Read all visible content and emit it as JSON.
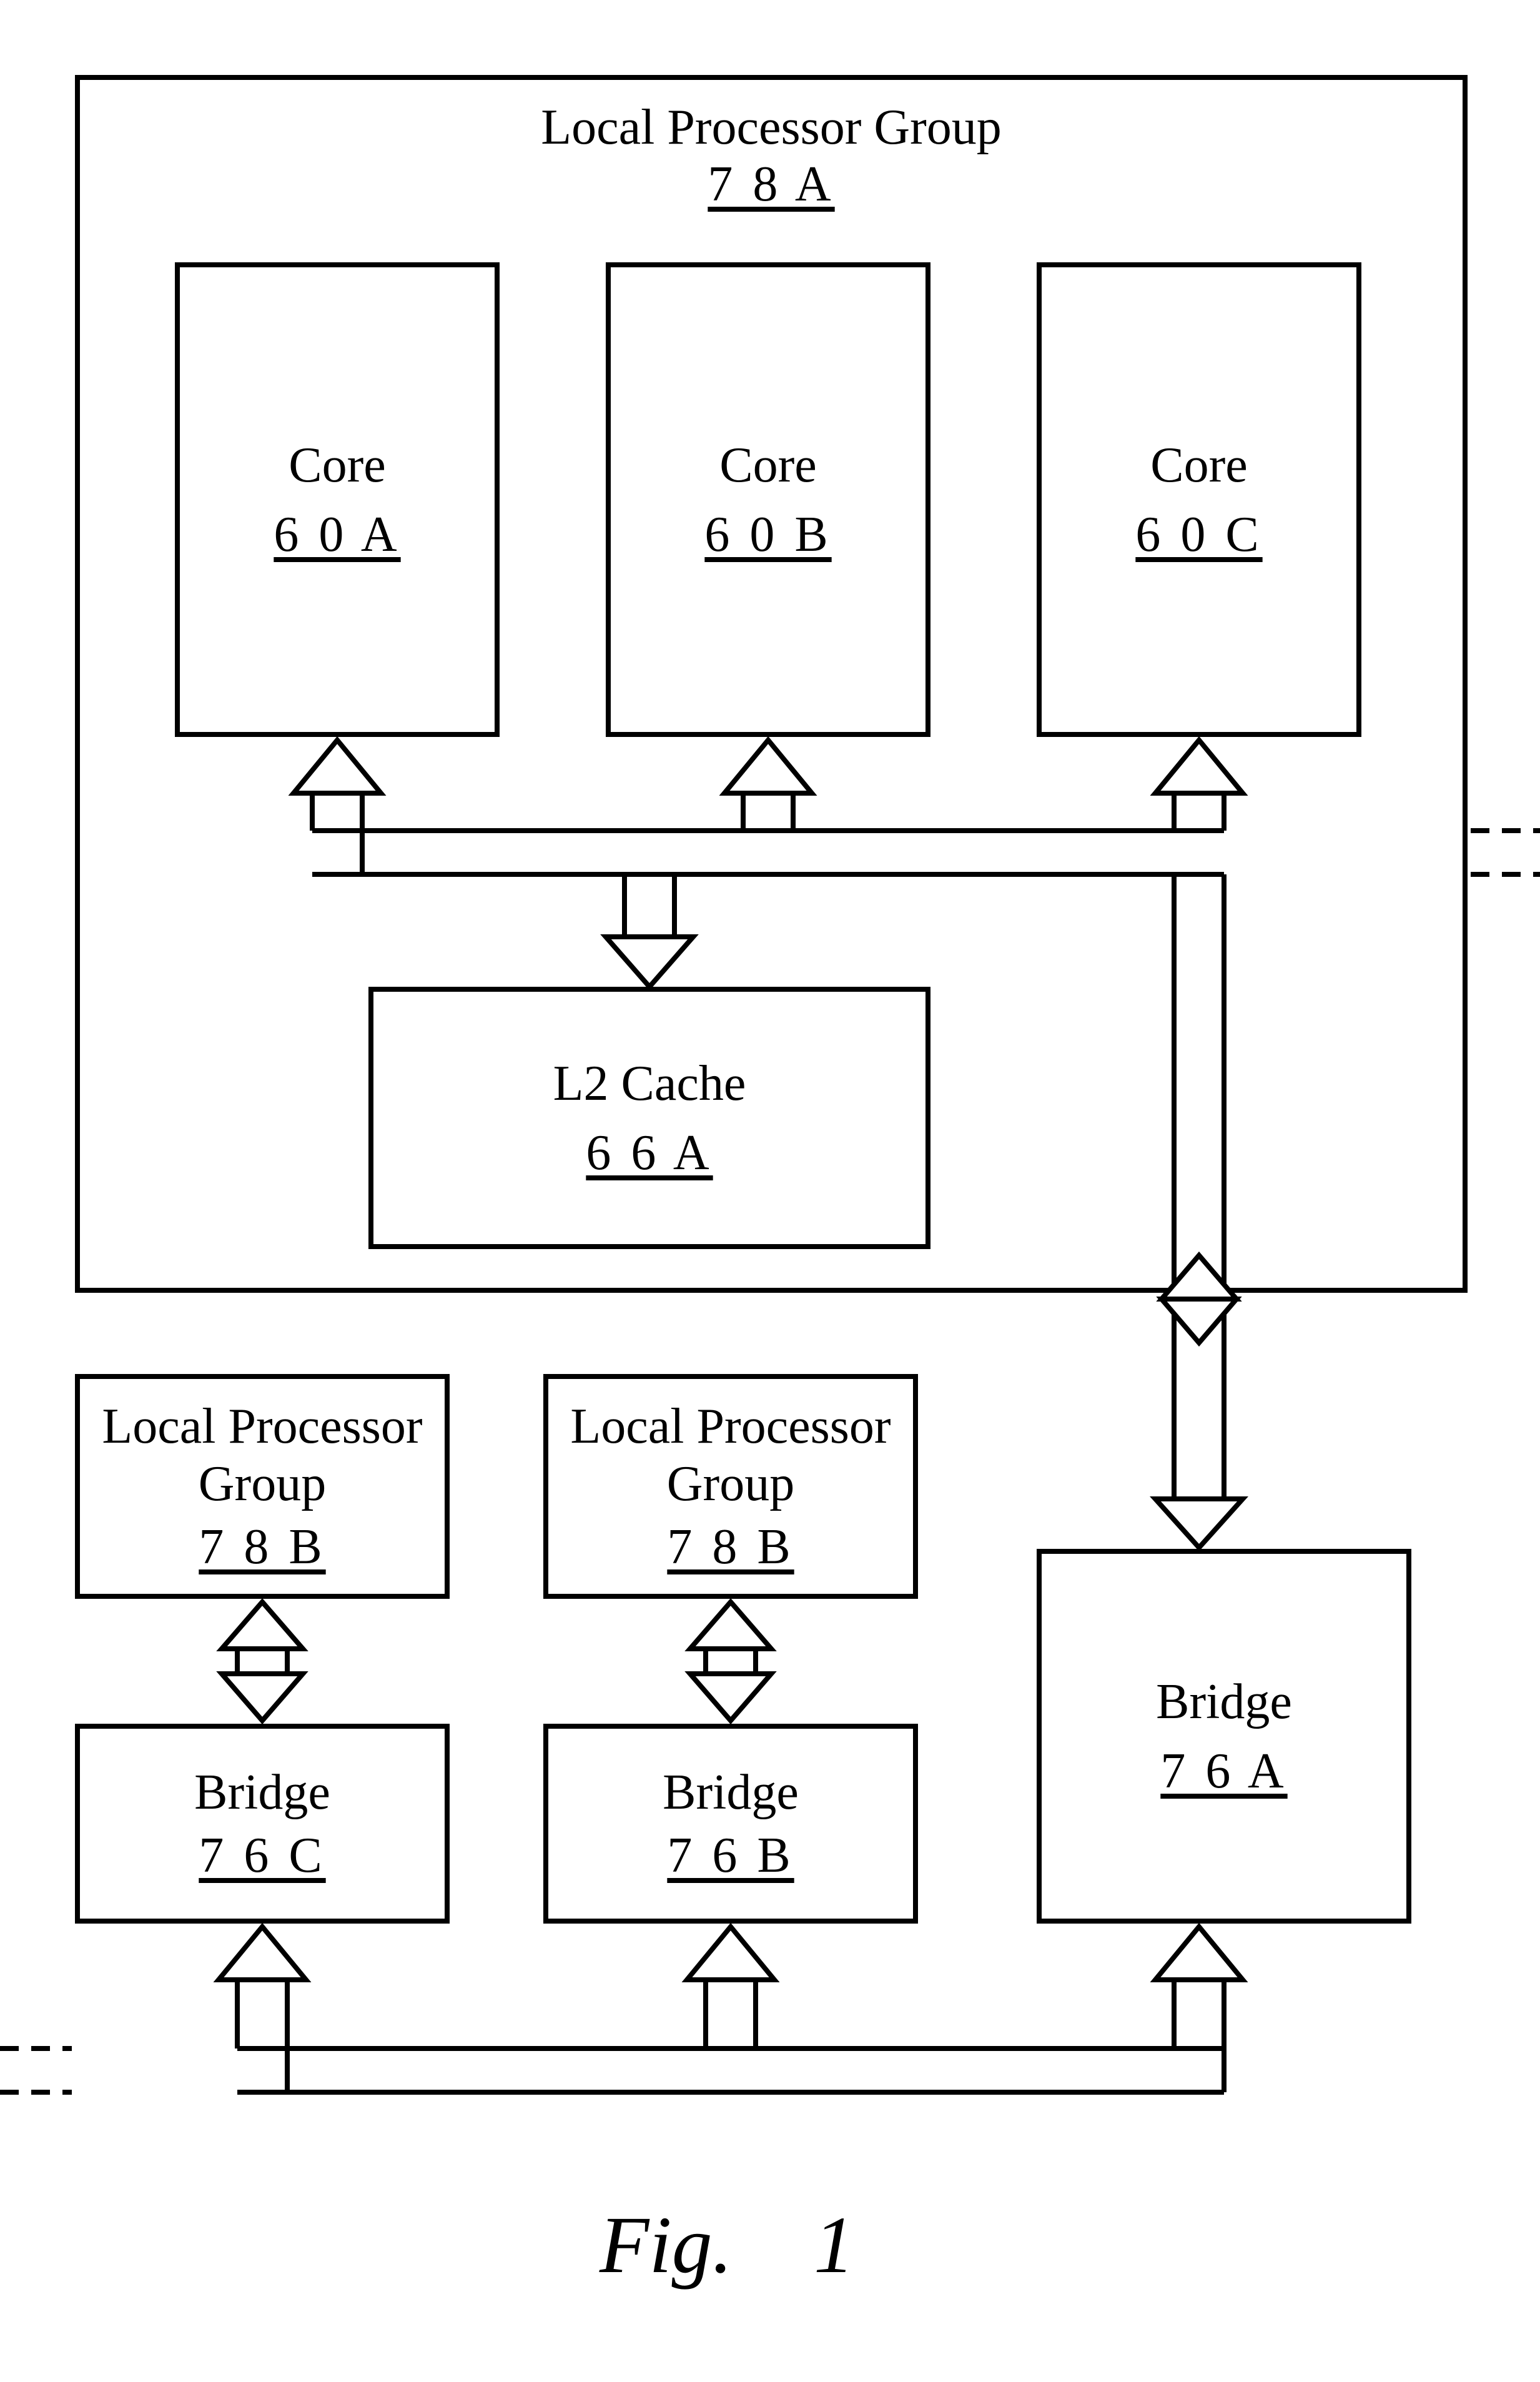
{
  "group78A": {
    "title": "Local Processor Group",
    "ref": "7 8 A"
  },
  "core60A": {
    "title": "Core",
    "ref": "6 0 A"
  },
  "core60B": {
    "title": "Core",
    "ref": "6 0 B"
  },
  "core60C": {
    "title": "Core",
    "ref": "6 0 C"
  },
  "l2cache": {
    "title": "L2 Cache",
    "ref": "6 6 A"
  },
  "group78B_left": {
    "title1": "Local Processor",
    "title2": "Group",
    "ref": "7 8 B"
  },
  "group78B_mid": {
    "title1": "Local Processor",
    "title2": "Group",
    "ref": "7 8 B"
  },
  "bridge76A": {
    "title": "Bridge",
    "ref": "7 6 A"
  },
  "bridge76B": {
    "title": "Bridge",
    "ref": "7 6 B"
  },
  "bridge76C": {
    "title": "Bridge",
    "ref": "7 6 C"
  },
  "figure": {
    "label": "Fig.",
    "num": "1"
  }
}
